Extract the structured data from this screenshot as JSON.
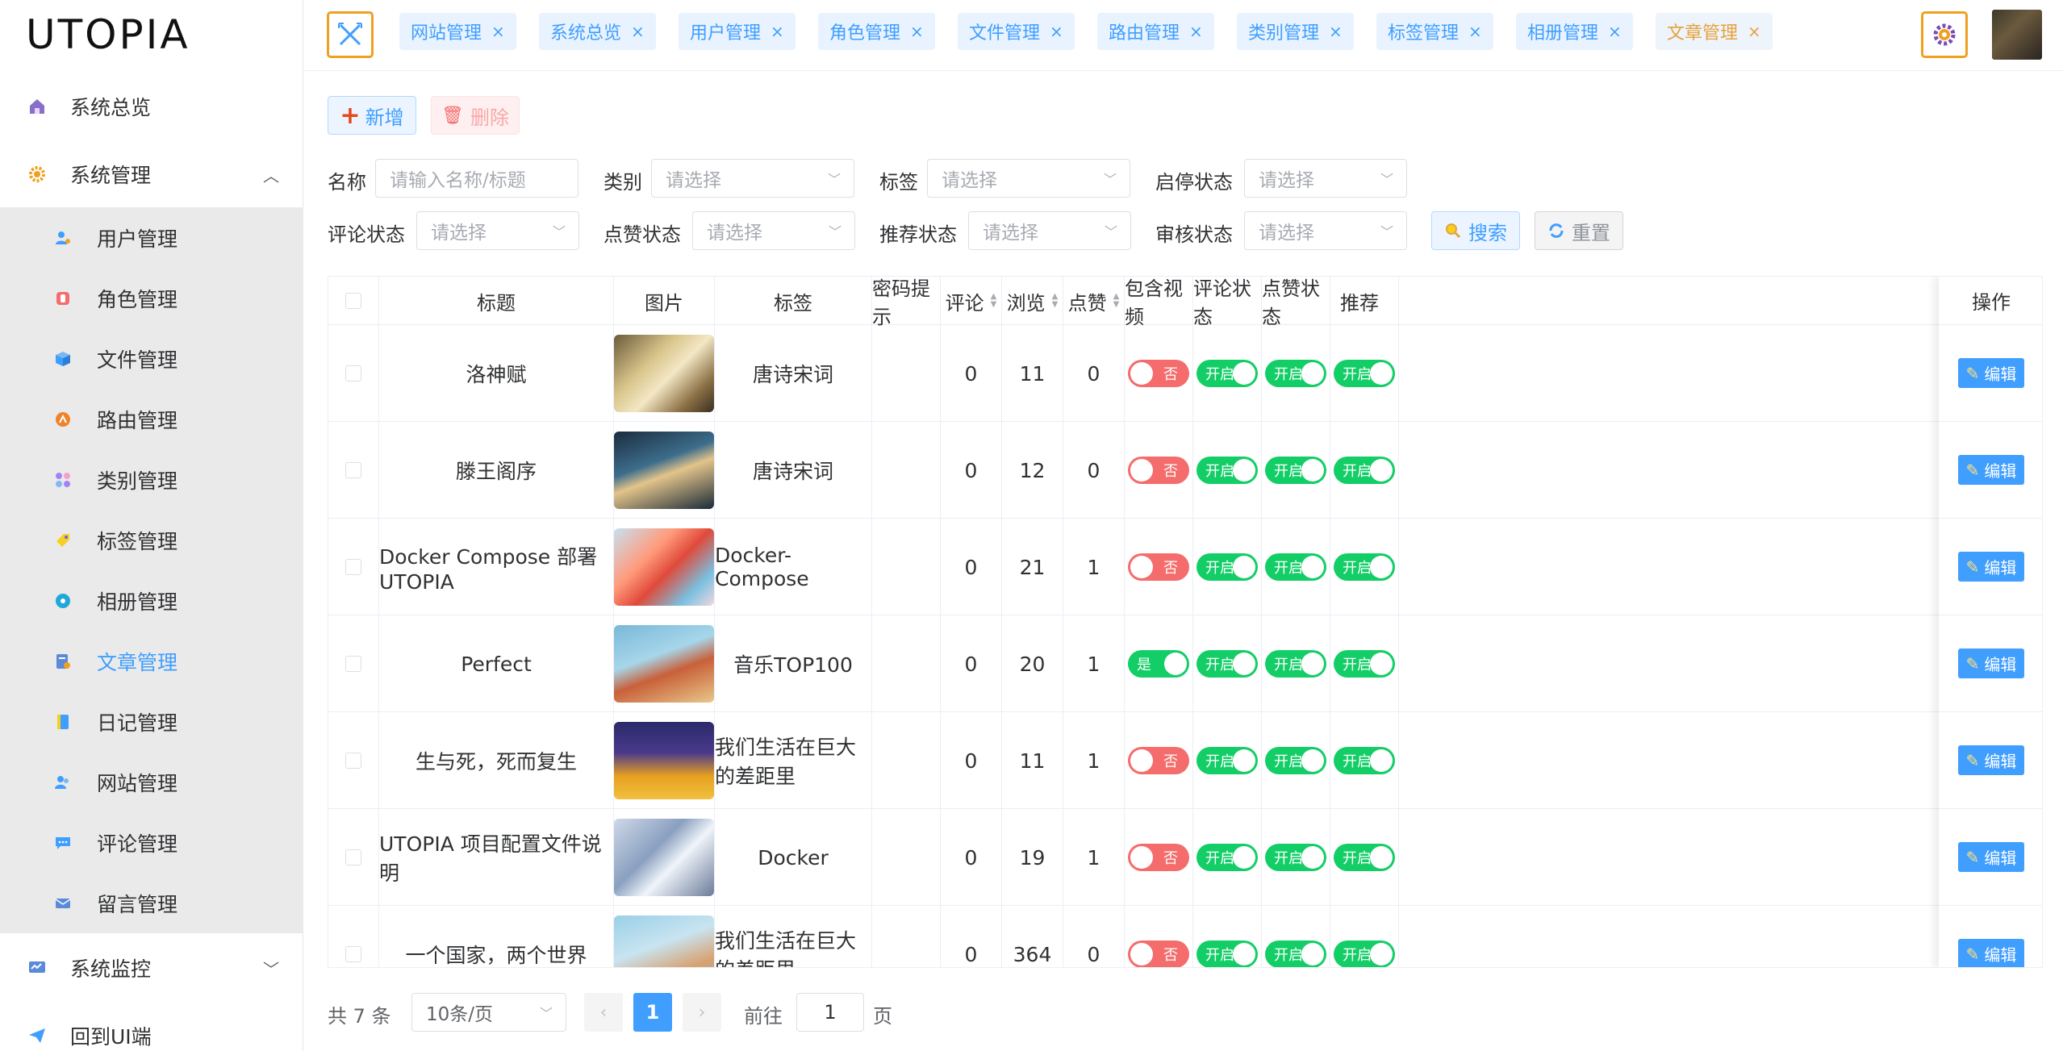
{
  "app": {
    "logo": "UTOPIA"
  },
  "sidebar": {
    "overview": "系统总览",
    "system": "系统管理",
    "sub_items": [
      {
        "label": "用户管理",
        "icon": "user-gear-icon"
      },
      {
        "label": "角色管理",
        "icon": "role-icon"
      },
      {
        "label": "文件管理",
        "icon": "box-icon"
      },
      {
        "label": "路由管理",
        "icon": "route-icon"
      },
      {
        "label": "类别管理",
        "icon": "category-icon"
      },
      {
        "label": "标签管理",
        "icon": "tag-icon"
      },
      {
        "label": "相册管理",
        "icon": "album-icon"
      },
      {
        "label": "文章管理",
        "icon": "article-icon"
      },
      {
        "label": "日记管理",
        "icon": "diary-icon"
      },
      {
        "label": "网站管理",
        "icon": "website-icon"
      },
      {
        "label": "评论管理",
        "icon": "comment-icon"
      },
      {
        "label": "留言管理",
        "icon": "message-icon"
      }
    ],
    "active_item": "文章管理",
    "monitor": "系统监控",
    "back_ui": "回到UI端"
  },
  "tabs": [
    {
      "label": "网站管理",
      "close": "×"
    },
    {
      "label": "系统总览",
      "close": "×"
    },
    {
      "label": "用户管理",
      "close": "×"
    },
    {
      "label": "角色管理",
      "close": "×"
    },
    {
      "label": "文件管理",
      "close": "×"
    },
    {
      "label": "路由管理",
      "close": "×"
    },
    {
      "label": "类别管理",
      "close": "×"
    },
    {
      "label": "标签管理",
      "close": "×"
    },
    {
      "label": "相册管理",
      "close": "×"
    },
    {
      "label": "文章管理",
      "close": "×"
    }
  ],
  "toolbar": {
    "add": "新增",
    "delete": "删除"
  },
  "filters": {
    "name_label": "名称",
    "name_placeholder": "请输入名称/标题",
    "category_label": "类别",
    "category_placeholder": "请选择",
    "tag_label": "标签",
    "tag_placeholder": "请选择",
    "enable_label": "启停状态",
    "enable_placeholder": "请选择",
    "comment_label": "评论状态",
    "comment_placeholder": "请选择",
    "like_label": "点赞状态",
    "like_placeholder": "请选择",
    "recommend_label": "推荐状态",
    "recommend_placeholder": "请选择",
    "audit_label": "审核状态",
    "audit_placeholder": "请选择",
    "search": "搜索",
    "reset": "重置"
  },
  "table": {
    "headers": {
      "title": "标题",
      "image": "图片",
      "tag": "标签",
      "password_hint": "密码提示",
      "comments": "评论",
      "views": "浏览",
      "likes": "点赞",
      "has_video": "包含视频",
      "comment_status": "评论状态",
      "like_status": "点赞状态",
      "recommend": "推荐",
      "actions": "操作"
    },
    "rows": [
      {
        "title": "洛神赋",
        "tag": "唐诗宋词",
        "comments": "0",
        "views": "11",
        "likes": "0",
        "video": "否",
        "comment_status": "开启",
        "like_status": "开启",
        "recommend": "开启",
        "edit": "编辑"
      },
      {
        "title": "滕王阁序",
        "tag": "唐诗宋词",
        "comments": "0",
        "views": "12",
        "likes": "0",
        "video": "否",
        "comment_status": "开启",
        "like_status": "开启",
        "recommend": "开启",
        "edit": "编辑"
      },
      {
        "title": "Docker Compose 部署 UTOPIA",
        "tag": "Docker-Compose",
        "comments": "0",
        "views": "21",
        "likes": "1",
        "video": "否",
        "comment_status": "开启",
        "like_status": "开启",
        "recommend": "开启",
        "edit": "编辑"
      },
      {
        "title": "Perfect",
        "tag": "音乐TOP100",
        "comments": "0",
        "views": "20",
        "likes": "1",
        "video": "是",
        "comment_status": "开启",
        "like_status": "开启",
        "recommend": "开启",
        "edit": "编辑"
      },
      {
        "title": "生与死，死而复生",
        "tag": "我们生活在巨大的差距里",
        "comments": "0",
        "views": "11",
        "likes": "1",
        "video": "否",
        "comment_status": "开启",
        "like_status": "开启",
        "recommend": "开启",
        "edit": "编辑"
      },
      {
        "title": "UTOPIA 项目配置文件说明",
        "tag": "Docker",
        "comments": "0",
        "views": "19",
        "likes": "1",
        "video": "否",
        "comment_status": "开启",
        "like_status": "开启",
        "recommend": "开启",
        "edit": "编辑"
      },
      {
        "title": "一个国家，两个世界",
        "tag": "我们生活在巨大的差距里",
        "comments": "0",
        "views": "364",
        "likes": "0",
        "video": "否",
        "comment_status": "开启",
        "like_status": "开启",
        "recommend": "开启",
        "edit": "编辑"
      }
    ]
  },
  "pagination": {
    "total": "共 7 条",
    "page_size": "10条/页",
    "current": "1",
    "goto": "前往",
    "goto_value": "1",
    "page": "页"
  },
  "colors": {
    "accent": "#409eff",
    "danger": "#f56c6c",
    "success": "#13ce66",
    "warning": "#e6a23c"
  }
}
